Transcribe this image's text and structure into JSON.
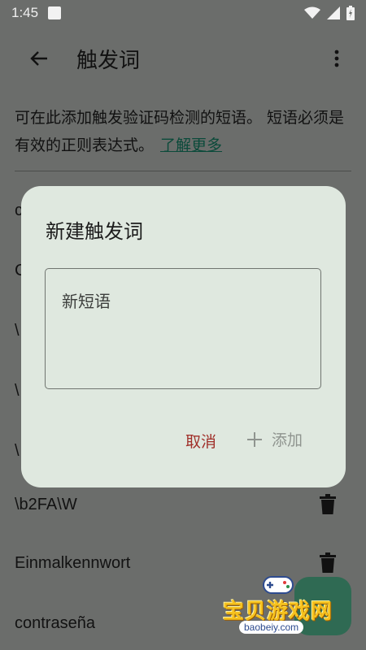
{
  "status_bar": {
    "time": "1:45"
  },
  "app_bar": {
    "title": "触发词"
  },
  "description": {
    "text": "可在此添加触发验证码检测的短语。 短语必须是有效的正则表达式。",
    "link": "了解更多"
  },
  "list": {
    "items": [
      {
        "label": "c"
      },
      {
        "label": "C"
      },
      {
        "label": "\\"
      },
      {
        "label": "\\"
      },
      {
        "label": "\\"
      },
      {
        "label": "\\b2FA\\W"
      },
      {
        "label": "Einmalkennwort"
      },
      {
        "label": "contraseña"
      }
    ]
  },
  "dialog": {
    "title": "新建触发词",
    "placeholder": "新短语",
    "cancel_label": "取消",
    "add_label": "添加"
  },
  "watermark": {
    "name": "宝贝游戏网",
    "domain": "baobeiy.com"
  },
  "colors": {
    "scrim": "#6b6d6b",
    "dialog_bg": "#dfe8df",
    "cancel": "#a0302a",
    "disabled": "#8f948f",
    "link": "#0b4a3a"
  }
}
